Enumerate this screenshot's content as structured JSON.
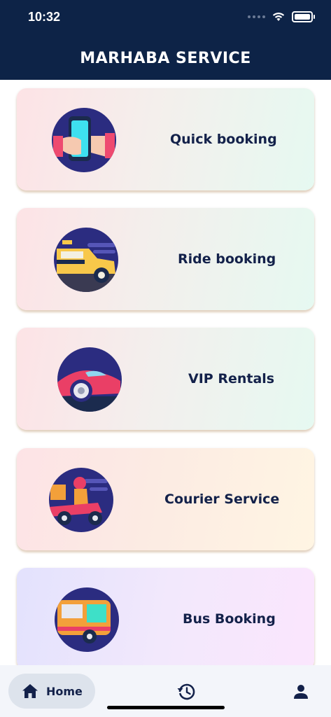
{
  "status_bar": {
    "time": "10:32"
  },
  "header": {
    "title": "MARHABA SERVICE"
  },
  "services": [
    {
      "label": "Quick booking",
      "icon": "phone-hand-icon"
    },
    {
      "label": "Ride booking",
      "icon": "taxi-icon"
    },
    {
      "label": "VIP Rentals",
      "icon": "sports-car-icon"
    },
    {
      "label": "Courier Service",
      "icon": "delivery-scooter-icon"
    },
    {
      "label": "Bus Booking",
      "icon": "bus-icon"
    }
  ],
  "bottom_nav": {
    "items": [
      {
        "label": "Home",
        "icon": "home-icon",
        "selected": true
      },
      {
        "label": "",
        "icon": "history-icon",
        "selected": false
      },
      {
        "label": "",
        "icon": "user-icon",
        "selected": false
      }
    ]
  },
  "colors": {
    "header_bg": "#0d2347",
    "text_dark": "#13214a",
    "icon_circle": "#2b2c80"
  }
}
